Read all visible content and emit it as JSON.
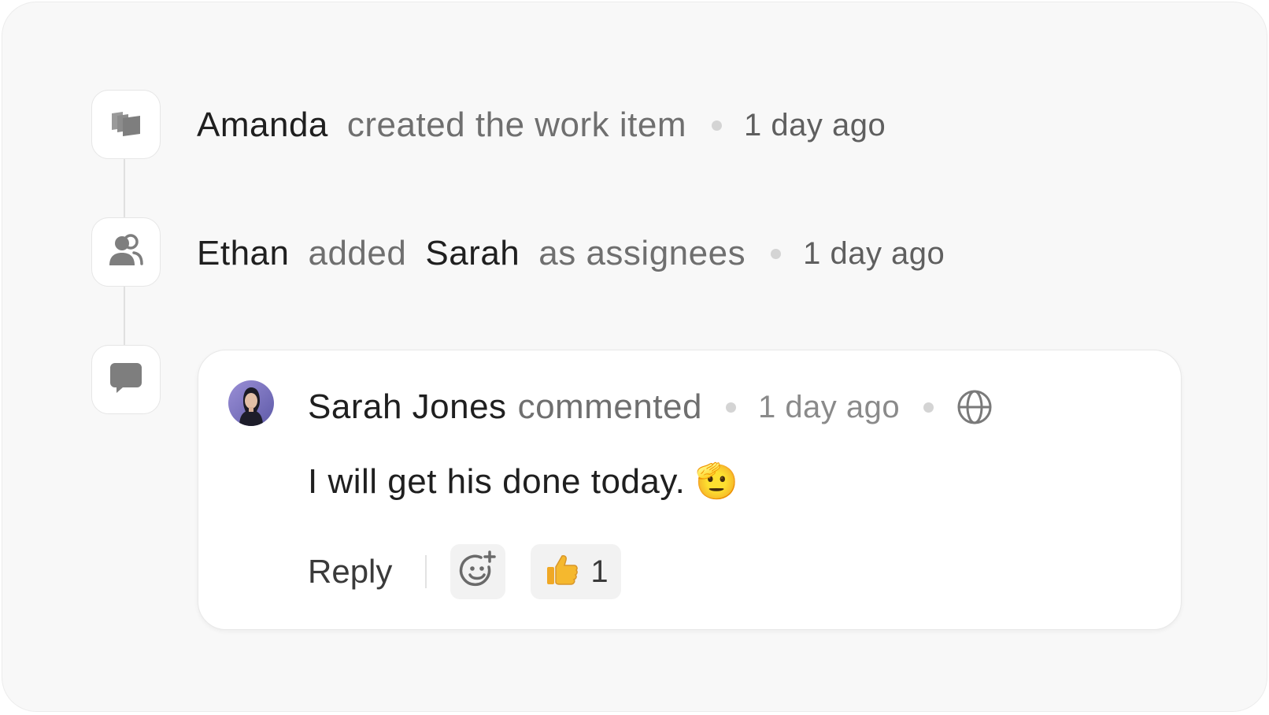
{
  "activity": [
    {
      "icon": "work-item-icon",
      "actor": "Amanda",
      "action": "created the work item",
      "time": "1 day ago"
    },
    {
      "icon": "users-icon",
      "actor": "Ethan",
      "action": "added",
      "target": "Sarah",
      "action_suffix": "as assignees",
      "time": "1 day ago"
    }
  ],
  "comment": {
    "icon": "comment-icon",
    "author": "Sarah Jones",
    "action": "commented",
    "time": "1 day ago",
    "visibility_icon": "globe-icon",
    "body": "I will get his done today. 🫡",
    "reply_label": "Reply",
    "add_reaction_icon": "add-emoji-icon",
    "reactions": [
      {
        "emoji": "thumbs-up-icon",
        "count": "1"
      }
    ]
  },
  "colors": {
    "background": "#f8f8f8",
    "card": "#ffffff",
    "text_primary": "#1f1f1f",
    "text_muted": "#6f6f6f",
    "icon_gray": "#8a8a8a",
    "reaction_bg": "#f2f2f2"
  }
}
